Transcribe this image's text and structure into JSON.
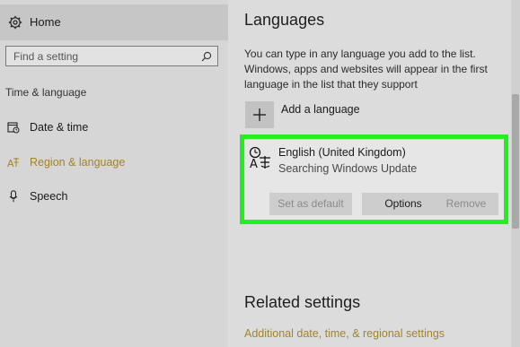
{
  "sidebar": {
    "home_label": "Home",
    "search_placeholder": "Find a setting",
    "section_title": "Time & language",
    "items": [
      {
        "label": "Date & time",
        "icon": "calendar-clock-icon"
      },
      {
        "label": "Region & language",
        "icon": "language-icon"
      },
      {
        "label": "Speech",
        "icon": "microphone-icon"
      }
    ]
  },
  "main": {
    "title": "Languages",
    "description": "You can type in any language you add to the list. Windows, apps and websites will appear in the first language in the list that they support",
    "add_language_label": "Add a language",
    "language_card": {
      "name": "English (United Kingdom)",
      "status": "Searching Windows Update",
      "buttons": {
        "set_default": "Set as default",
        "options": "Options",
        "remove": "Remove"
      }
    },
    "related_title": "Related settings",
    "related_link": "Additional date, time, & regional settings"
  },
  "colors": {
    "accent": "#a38426",
    "highlight_border": "#22ee22"
  }
}
